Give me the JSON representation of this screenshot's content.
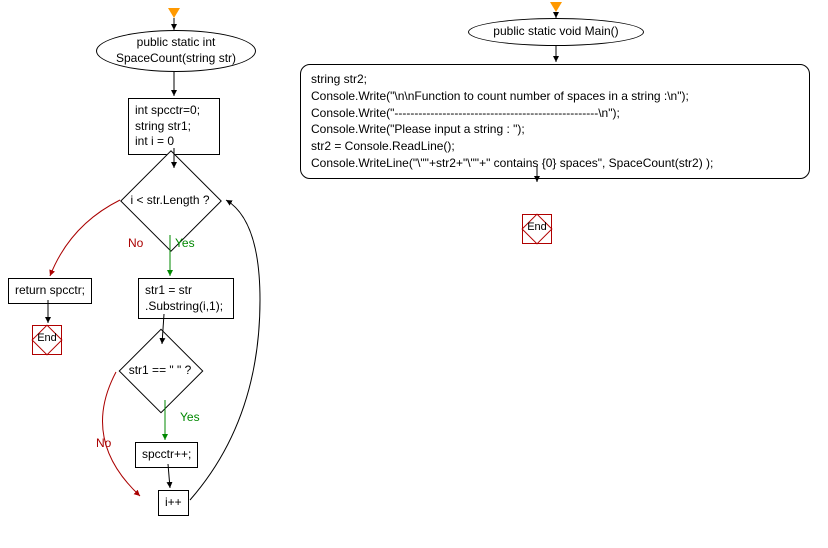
{
  "left": {
    "func_sig": "public static int\nSpaceCount(string str)",
    "init_block": "int spcctr=0;\nstring str1;\nint i = 0",
    "cond1": "i < str.Length ?",
    "return_stmt": "return spcctr;",
    "assign": "str1 = str\n.Substring(i,1);",
    "cond2": "str1 == \" \" ?",
    "inc": "spcctr++;",
    "iinc": "i++",
    "end": "End"
  },
  "right": {
    "main_sig": "public static void Main()",
    "body_l1": "string str2;",
    "body_l2": "Console.Write(\"\\n\\nFunction to count number of spaces in a string :\\n\");",
    "body_l3": "Console.Write(\"---------------------------------------------------\\n\");",
    "body_l4": "Console.Write(\"Please input a string : \");",
    "body_l5": "str2 = Console.ReadLine();",
    "body_l6": "Console.WriteLine(\"\\\"\"+str2+\"\\\"\"+\" contains {0} spaces\", SpaceCount(str2) );",
    "end": "End"
  },
  "labels": {
    "yes": "Yes",
    "no": "No"
  }
}
